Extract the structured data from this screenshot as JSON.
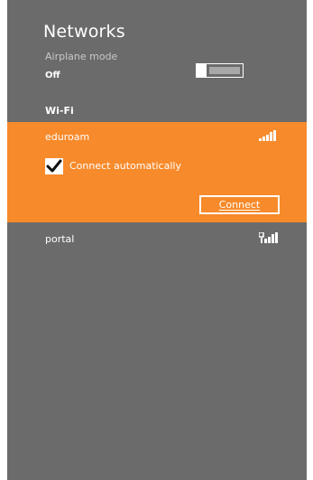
{
  "networks_panel": {
    "title": "Networks",
    "airplane_mode": {
      "label": "Airplane mode",
      "state": "Off",
      "enabled": false
    },
    "wifi_header": "Wi-Fi",
    "networks": [
      {
        "name": "eduroam",
        "selected": true,
        "signal_icon": "wifi-signal-icon",
        "connect_automatically": {
          "label": "Connect automatically",
          "checked": true
        },
        "connect_button": "Connect"
      },
      {
        "name": "portal",
        "selected": false,
        "signal_icon": "wifi-signal-open-icon"
      }
    ]
  },
  "colors": {
    "panel_background": "#6b6b6b",
    "selected_background": "#f78a2a",
    "text": "#ffffff",
    "muted_text": "#c9c9c9"
  }
}
